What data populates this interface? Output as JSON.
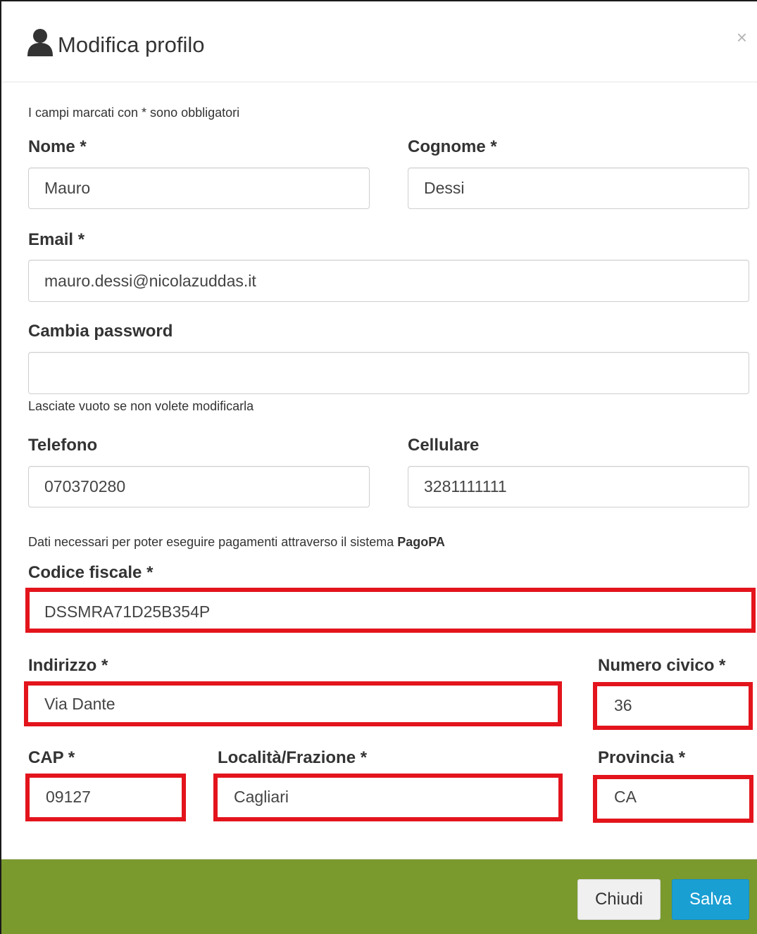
{
  "dialog": {
    "title": "Modifica profilo",
    "close_symbol": "×",
    "icon": "user-icon"
  },
  "form": {
    "required_note": "I campi marcati con * sono obbligatori",
    "nome": {
      "label": "Nome *",
      "value": "Mauro"
    },
    "cognome": {
      "label": "Cognome *",
      "value": "Dessi"
    },
    "email": {
      "label": "Email *",
      "value": "mauro.dessi@nicolazuddas.it"
    },
    "password": {
      "label": "Cambia password",
      "value": "",
      "help": "Lasciate vuoto se non volete modificarla"
    },
    "telefono": {
      "label": "Telefono",
      "value": "070370280"
    },
    "cellulare": {
      "label": "Cellulare",
      "value": "3281111111"
    },
    "pagopa_note_prefix": "Dati necessari per poter eseguire pagamenti attraverso il sistema ",
    "pagopa_note_brand": "PagoPA",
    "codice_fiscale": {
      "label": "Codice fiscale *",
      "value": "DSSMRA71D25B354P"
    },
    "indirizzo": {
      "label": "Indirizzo *",
      "value": "Via Dante"
    },
    "numero_civico": {
      "label": "Numero civico *",
      "value": "36"
    },
    "cap": {
      "label": "CAP *",
      "value": "09127"
    },
    "localita": {
      "label": "Località/Frazione *",
      "value": "Cagliari"
    },
    "provincia": {
      "label": "Provincia *",
      "value": "CA"
    }
  },
  "footer": {
    "close_label": "Chiudi",
    "save_label": "Salva"
  },
  "colors": {
    "highlight": "#e3141c",
    "footer_bg": "#7a9a2d",
    "primary_button": "#1a9fd3"
  }
}
